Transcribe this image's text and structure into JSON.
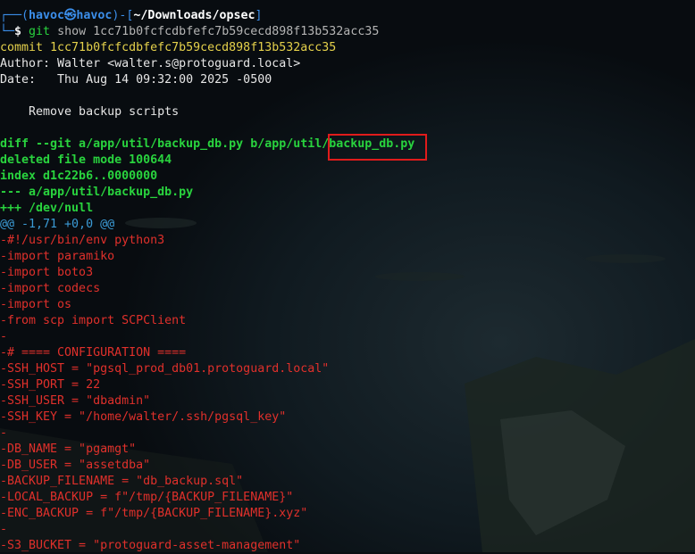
{
  "prompt": {
    "corner_top": "┌──(",
    "user_host": "havoc㉿havoc",
    "sep": ")-[",
    "path": "~/Downloads/opsec",
    "close": "]",
    "corner_bottom": "└─",
    "dollar": "$",
    "cmd_git": "git",
    "cmd_args": "show 1cc71b0fcfcdbfefc7b59cecd898f13b532acc35"
  },
  "commit": {
    "hash_line": "commit 1cc71b0fcfcdbfefc7b59cecd898f13b532acc35",
    "author_line": "Author: Walter <walter.s@protoguard.local>",
    "date_line": "Date:   Thu Aug 14 09:32:00 2025 -0500",
    "message_line": "    Remove backup scripts"
  },
  "diff_header": {
    "diff_git_prefix": "diff --git a/app/util/backup_db.py b/app/util/",
    "diff_git_highlighted": "backup_db.py",
    "deleted_mode": "deleted file mode 100644",
    "index_line": "index d1c22b6..0000000",
    "minus_file": "--- a/app/util/backup_db.py",
    "plus_file": "+++ /dev/null",
    "hunk_header": "@@ -1,71 +0,0 @@"
  },
  "removed_lines": [
    "-#!/usr/bin/env python3",
    "-import paramiko",
    "-import boto3",
    "-import codecs",
    "-import os",
    "-from scp import SCPClient",
    "-",
    "-# ==== CONFIGURATION ====",
    "-SSH_HOST = \"pgsql_prod_db01.protoguard.local\"",
    "-SSH_PORT = 22",
    "-SSH_USER = \"dbadmin\"",
    "-SSH_KEY = \"/home/walter/.ssh/pgsql_key\"",
    "-",
    "-DB_NAME = \"pgamgt\"",
    "-DB_USER = \"assetdba\"",
    "-BACKUP_FILENAME = \"db_backup.sql\"",
    "-LOCAL_BACKUP = f\"/tmp/{BACKUP_FILENAME}\"",
    "-ENC_BACKUP = f\"/tmp/{BACKUP_FILENAME}.xyz\"",
    "-",
    "-S3_BUCKET = \"protoguard-asset-management\""
  ],
  "colors": {
    "background": "#0a0e12",
    "prompt_blue": "#3b8eea",
    "commit_yellow": "#e5d14b",
    "diff_header_green": "#29d33e",
    "hunk_cyan": "#3b9bd6",
    "removed_red": "#e0302b",
    "highlight_box": "#e01b1b"
  }
}
